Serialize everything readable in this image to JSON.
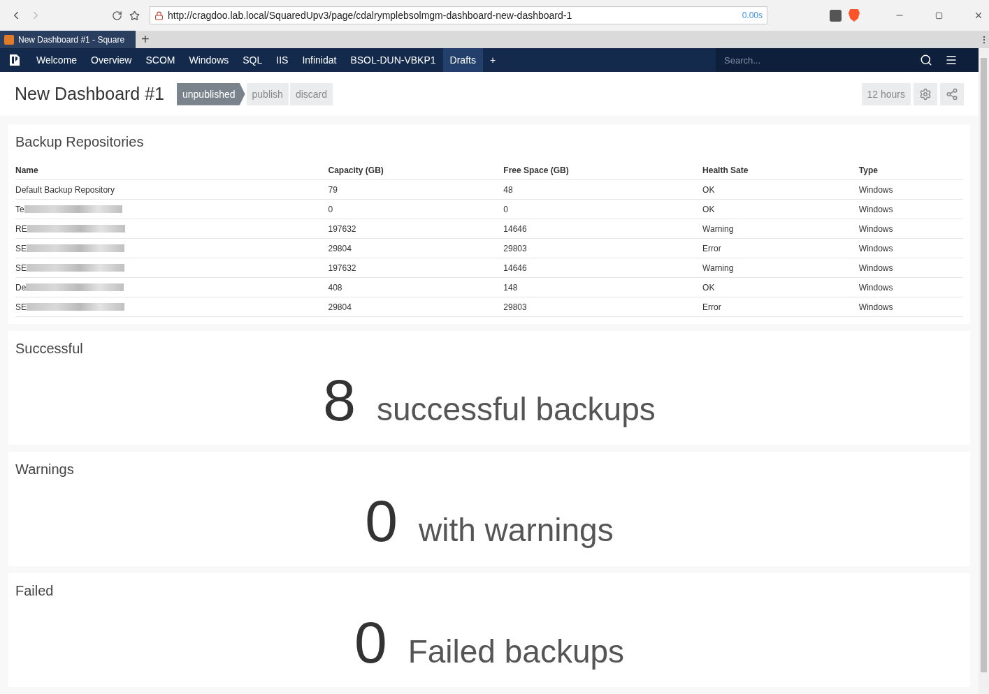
{
  "browser": {
    "url": "http://cragdoo.lab.local/SquaredUpv3/page/cdalrymplebsolmgm-dashboard-new-dashboard-1",
    "load_time": "0.00s",
    "tab_title": "New Dashboard #1 - Square",
    "new_tab": "+"
  },
  "nav": {
    "items": [
      {
        "label": "Welcome",
        "selected": false
      },
      {
        "label": "Overview",
        "selected": false
      },
      {
        "label": "SCOM",
        "selected": false
      },
      {
        "label": "Windows",
        "selected": false
      },
      {
        "label": "SQL",
        "selected": false
      },
      {
        "label": "IIS",
        "selected": false
      },
      {
        "label": "Infinidat",
        "selected": false
      },
      {
        "label": "BSOL-DUN-VBKP1",
        "selected": false
      },
      {
        "label": "Drafts",
        "selected": true
      }
    ],
    "add": "+",
    "search": {
      "placeholder": "Search..."
    }
  },
  "header": {
    "title": "New Dashboard #1",
    "status": "unpublished",
    "actions": [
      "publish",
      "discard"
    ],
    "timeframe": "12 hours"
  },
  "repositories": {
    "title": "Backup Repositories",
    "columns": [
      "Name",
      "Capacity (GB)",
      "Free Space (GB)",
      "Health Sate",
      "Type"
    ],
    "rows": [
      {
        "name": "Default Backup Repository",
        "blurred": false,
        "capacity": "79",
        "free": "48",
        "health": "OK",
        "type": "Windows"
      },
      {
        "name": "Te",
        "blurred": true,
        "capacity": "0",
        "free": "0",
        "health": "OK",
        "type": "Windows"
      },
      {
        "name": "RE",
        "blurred": true,
        "capacity": "197632",
        "free": "14646",
        "health": "Warning",
        "type": "Windows"
      },
      {
        "name": "SE",
        "blurred": true,
        "capacity": "29804",
        "free": "29803",
        "health": "Error",
        "type": "Windows"
      },
      {
        "name": "SE",
        "blurred": true,
        "capacity": "197632",
        "free": "14646",
        "health": "Warning",
        "type": "Windows"
      },
      {
        "name": "De",
        "blurred": true,
        "capacity": "408",
        "free": "148",
        "health": "OK",
        "type": "Windows"
      },
      {
        "name": "SE",
        "blurred": true,
        "capacity": "29804",
        "free": "29803",
        "health": "Error",
        "type": "Windows"
      }
    ]
  },
  "stats": [
    {
      "title": "Successful",
      "value": "8",
      "caption": "successful backups"
    },
    {
      "title": "Warnings",
      "value": "0",
      "caption": "with warnings"
    },
    {
      "title": "Failed",
      "value": "0",
      "caption": "Failed backups"
    }
  ]
}
